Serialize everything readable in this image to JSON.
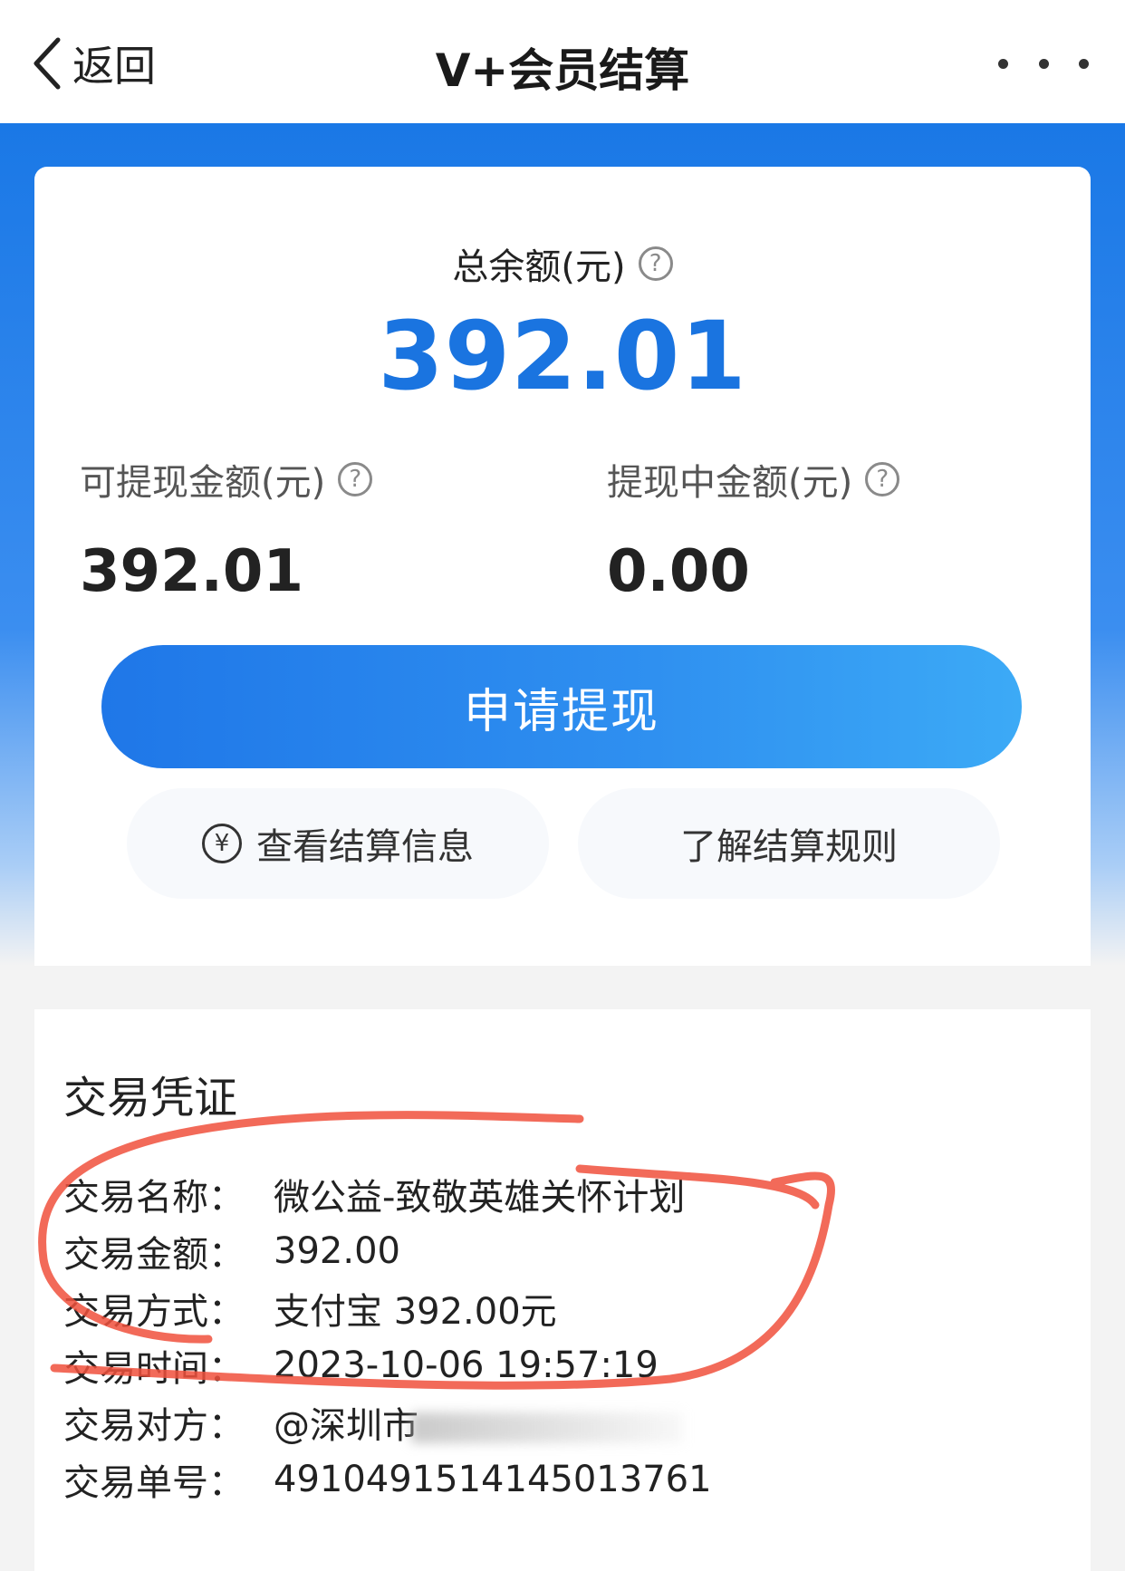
{
  "nav": {
    "back_label": "返回",
    "title": "V+会员结算"
  },
  "balance": {
    "total_label": "总余额(元)",
    "total_value": "392.01",
    "withdrawable_label": "可提现金额(元)",
    "withdrawable_value": "392.01",
    "pending_label": "提现中金额(元)",
    "pending_value": "0.00",
    "help_glyph": "?"
  },
  "actions": {
    "withdraw_label": "申请提现",
    "view_settlement_label": "查看结算信息",
    "rules_label": "了解结算规则",
    "yen_glyph": "¥"
  },
  "voucher": {
    "title": "交易凭证",
    "rows": [
      {
        "label": "交易名称：",
        "value": "微公益-致敬英雄关怀计划"
      },
      {
        "label": "交易金额：",
        "value": "392.00"
      },
      {
        "label": "交易方式：",
        "value": "支付宝 392.00元"
      },
      {
        "label": "交易时间：",
        "value": "2023-10-06 19:57:19"
      },
      {
        "label": "交易对方：",
        "value": "@深圳市"
      },
      {
        "label": "交易单号：",
        "value": "4910491514145013761"
      }
    ]
  },
  "colors": {
    "accent": "#1a74e0",
    "annotation": "#f0503c"
  },
  "icons": [
    "back-chevron-icon",
    "more-icon",
    "help-icon",
    "yen-icon"
  ]
}
